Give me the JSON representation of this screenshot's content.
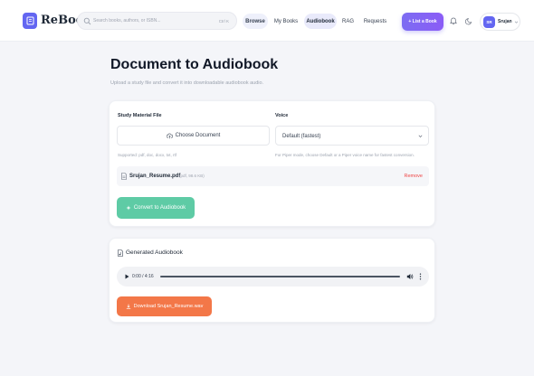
{
  "app": {
    "name": "ReBook"
  },
  "header": {
    "search_placeholder": "Search books, authors, or ISBN...",
    "search_shortcut": "Ctrl K",
    "nav": [
      {
        "label": "Browse"
      },
      {
        "label": "My Books"
      },
      {
        "label": "Audiobook"
      },
      {
        "label": "RAG"
      },
      {
        "label": "Requests"
      }
    ],
    "list_book_label": "+ List a Book",
    "user": {
      "initials": "SR",
      "name": "Srujan"
    }
  },
  "page": {
    "title": "Document to Audiobook",
    "subtitle": "Upload a study file and convert it into downloadable audiobook audio."
  },
  "form": {
    "file_label": "Study Material File",
    "choose_label": "Choose Document",
    "file_hint": "Supported: pdf, doc, docx, txt, rtf",
    "voice_label": "Voice",
    "voice_value": "Default (fastest)",
    "voice_hint": "For Piper mode, choose Default or a Piper voice name for fastest conversion.",
    "selected_file": {
      "name": "Srujan_Resume.pdf",
      "meta": "(pdf, 98.6 KB)",
      "remove_label": "Remove"
    },
    "convert_label": "Convert to Audiobook"
  },
  "result": {
    "title": "Generated Audiobook",
    "player": {
      "time": "0:00 / 4:16"
    },
    "download_label": "Download Srujan_Resume.wav"
  },
  "colors": {
    "brand": "#6366f1",
    "convert": "#5ecba5",
    "download": "#f37748",
    "remove": "#ef4444"
  }
}
